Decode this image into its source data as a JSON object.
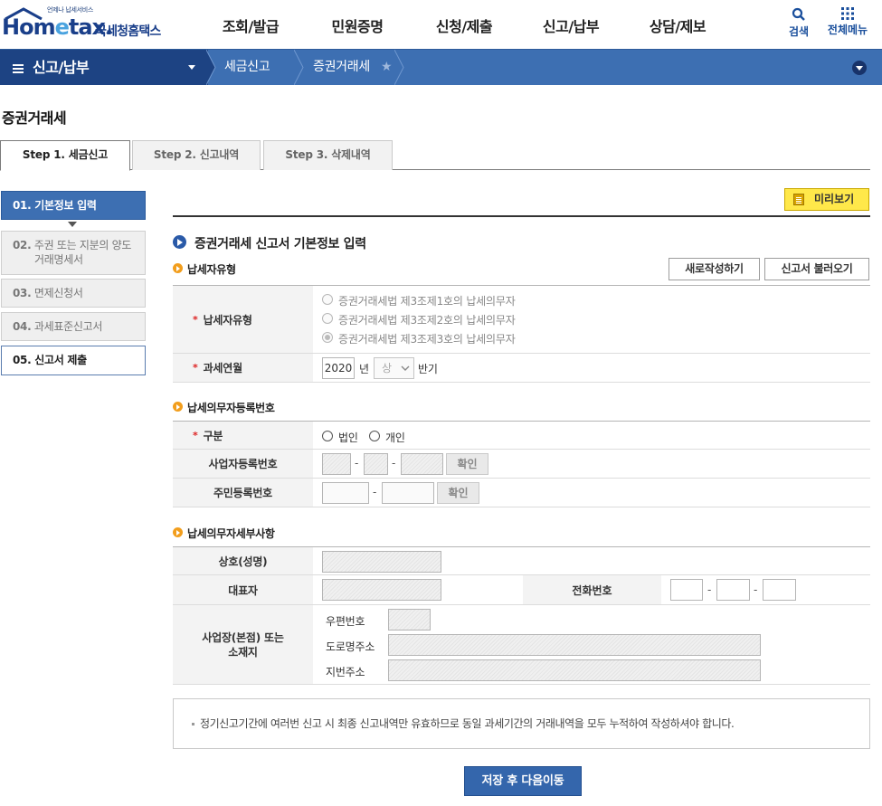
{
  "header": {
    "logo_sub": "언제나 납세서비스",
    "logo_main_a": "Hom",
    "logo_main_e": "e",
    "logo_main_b": "tax.",
    "logo_kr": "국세청홈택스",
    "gnb": [
      "조회/발급",
      "민원증명",
      "신청/제출",
      "신고/납부",
      "상담/제보"
    ],
    "search_label": "검색",
    "menu_label": "전체메뉴"
  },
  "locbar": {
    "main": "신고/납부",
    "crumb1": "세금신고",
    "crumb2": "증권거래세"
  },
  "page_title": "증권거래세",
  "step_tabs": [
    "Step 1. 세금신고",
    "Step 2. 신고내역",
    "Step 3. 삭제내역"
  ],
  "side_steps": {
    "s1_num": "01.",
    "s1": "기본정보 입력",
    "s2_num": "02.",
    "s2_l1": "주권 또는 지분의 양도",
    "s2_l2": "거래명세서",
    "s3_num": "03.",
    "s3": "면제신청서",
    "s4_num": "04.",
    "s4": "과세표준신고서",
    "s5_num": "05.",
    "s5": "신고서 제출"
  },
  "main": {
    "preview_label": "미리보기",
    "section_title": "증권거래세 신고서 기본정보 입력",
    "sub1": "납세자유형",
    "new_btn": "새로작성하기",
    "load_btn": "신고서 불러오기",
    "taxpayer_type_label": "납세자유형",
    "taxpayer_options": [
      "증권거래세법 제3조제1호의 납세의무자",
      "증권거래세법 제3조제2호의 납세의무자",
      "증권거래세법 제3조제3호의 납세의무자"
    ],
    "period_label": "과세연월",
    "year_value": "2020",
    "year_unit": "년",
    "half_value": "상",
    "half_unit": "반기",
    "sub2": "납세의무자등록번호",
    "type_label": "구분",
    "corp": "법인",
    "indiv": "개인",
    "biz_no_label": "사업자등록번호",
    "confirm1": "확인",
    "rrn_label": "주민등록번호",
    "confirm2": "확인",
    "dash": "-",
    "sub3": "납세의무자세부사항",
    "name_label": "상호(성명)",
    "rep_label": "대표자",
    "phone_label": "전화번호",
    "addr_label_1": "사업장(본점) 또는",
    "addr_label_2": "소재지",
    "postal_label": "우편번호",
    "road_label": "도로명주소",
    "lot_label": "지번주소",
    "notice": "정기신고기간에 여러번 신고 시 최종 신고내역만 유효하므로 동일 과세기간의 거래내역을 모두 누적하여 작성하셔야 합니다.",
    "save_btn": "저장 후 다음이동"
  },
  "colors": {
    "brand_navy": "#1d4383",
    "brand_blue": "#3d6fb2",
    "preview_yellow": "#ffe84a",
    "required_red": "#dd2222",
    "sub_dot_orange": "#f29e1d"
  }
}
